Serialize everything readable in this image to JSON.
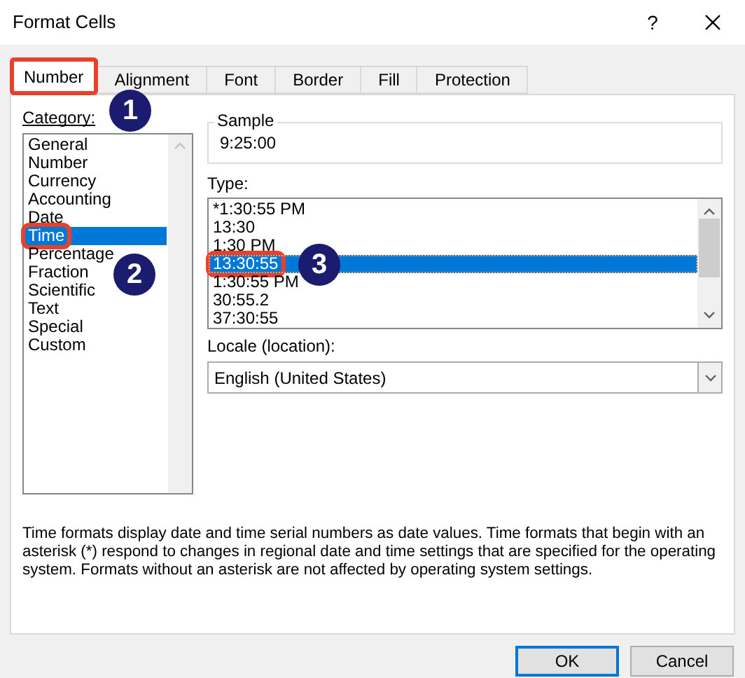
{
  "window": {
    "title": "Format Cells",
    "help": "?"
  },
  "tabs": [
    {
      "label": "Number",
      "selected": true,
      "highlighted": true
    },
    {
      "label": "Alignment",
      "selected": false,
      "highlighted": false
    },
    {
      "label": "Font",
      "selected": false,
      "highlighted": false
    },
    {
      "label": "Border",
      "selected": false,
      "highlighted": false
    },
    {
      "label": "Fill",
      "selected": false,
      "highlighted": false
    },
    {
      "label": "Protection",
      "selected": false,
      "highlighted": false
    }
  ],
  "category": {
    "label": "Category:",
    "items": [
      {
        "label": "General",
        "selected": false,
        "highlighted": false
      },
      {
        "label": "Number",
        "selected": false,
        "highlighted": false
      },
      {
        "label": "Currency",
        "selected": false,
        "highlighted": false
      },
      {
        "label": "Accounting",
        "selected": false,
        "highlighted": false
      },
      {
        "label": "Date",
        "selected": false,
        "highlighted": false
      },
      {
        "label": "Time",
        "selected": true,
        "highlighted": true
      },
      {
        "label": "Percentage",
        "selected": false,
        "highlighted": false
      },
      {
        "label": "Fraction",
        "selected": false,
        "highlighted": false
      },
      {
        "label": "Scientific",
        "selected": false,
        "highlighted": false
      },
      {
        "label": "Text",
        "selected": false,
        "highlighted": false
      },
      {
        "label": "Special",
        "selected": false,
        "highlighted": false
      },
      {
        "label": "Custom",
        "selected": false,
        "highlighted": false
      }
    ]
  },
  "sample": {
    "label": "Sample",
    "value": "9:25:00"
  },
  "type": {
    "label": "Type:",
    "items": [
      {
        "label": "*1:30:55 PM",
        "selected": false,
        "highlighted": false
      },
      {
        "label": "13:30",
        "selected": false,
        "highlighted": false
      },
      {
        "label": "1:30 PM",
        "selected": false,
        "highlighted": false
      },
      {
        "label": "13:30:55",
        "selected": true,
        "highlighted": true
      },
      {
        "label": "1:30:55 PM",
        "selected": false,
        "highlighted": false
      },
      {
        "label": "30:55.2",
        "selected": false,
        "highlighted": false
      },
      {
        "label": "37:30:55",
        "selected": false,
        "highlighted": false
      }
    ]
  },
  "locale": {
    "label": "Locale (location):",
    "value": "English (United States)"
  },
  "description": "Time formats display date and time serial numbers as date values.  Time formats that begin with an asterisk (*) respond to changes in regional date and time settings that are specified for the operating system. Formats without an asterisk are not affected by operating system settings.",
  "buttons": [
    {
      "label": "OK",
      "default": true
    },
    {
      "label": "Cancel",
      "default": false
    }
  ],
  "callouts": [
    {
      "label": "1"
    },
    {
      "label": "2"
    },
    {
      "label": "3"
    }
  ]
}
